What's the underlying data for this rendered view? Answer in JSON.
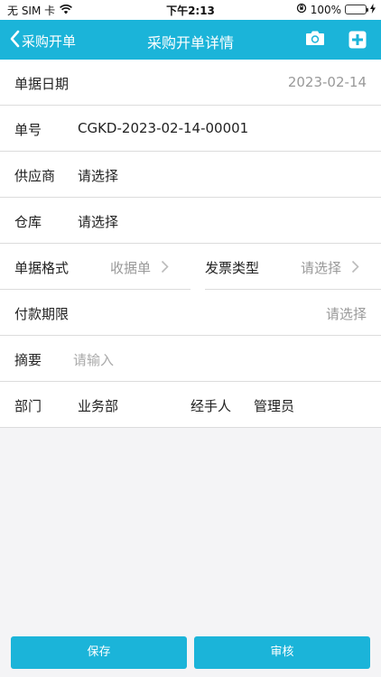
{
  "status_bar": {
    "carrier": "无 SIM 卡",
    "time": "下午2:13",
    "battery": "100%"
  },
  "nav": {
    "back_label": "采购开单",
    "title": "采购开单详情"
  },
  "form": {
    "date": {
      "label": "单据日期",
      "value": "2023-02-14"
    },
    "number": {
      "label": "单号",
      "value": "CGKD-2023-02-14-00001"
    },
    "supplier": {
      "label": "供应商",
      "value": "请选择"
    },
    "warehouse": {
      "label": "仓库",
      "value": "请选择"
    },
    "format": {
      "label": "单据格式",
      "value": "收据单"
    },
    "invoice_type": {
      "label": "发票类型",
      "value": "请选择"
    },
    "payment_term": {
      "label": "付款期限",
      "value": "请选择"
    },
    "summary": {
      "label": "摘要",
      "placeholder": "请输入"
    },
    "department": {
      "label": "部门",
      "value": "业务部"
    },
    "handler": {
      "label": "经手人",
      "value": "管理员"
    }
  },
  "buttons": {
    "save": "保存",
    "review": "审核"
  },
  "colors": {
    "accent": "#1bb4d9"
  }
}
